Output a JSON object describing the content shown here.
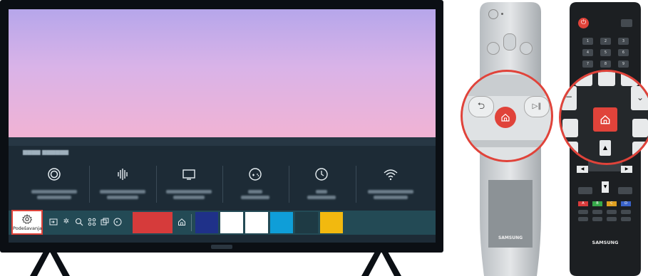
{
  "tv": {
    "settings_label": "Podešavanja",
    "bar_icons": [
      "input-source-icon",
      "ambient-icon",
      "search-icon",
      "apps-icon",
      "multi-view-icon",
      "gaming-hub-icon"
    ],
    "quick_settings_icons": [
      "picture-mode-icon",
      "sound-output-icon",
      "display-icon",
      "game-mode-icon",
      "sleep-timer-icon",
      "network-icon"
    ],
    "app_tiles": [
      {
        "name": "red",
        "color": "#d63b3b"
      },
      {
        "name": "navy",
        "color": "#1f3189"
      },
      {
        "name": "white1",
        "color": "#ffffff"
      },
      {
        "name": "white2",
        "color": "#ffffff"
      },
      {
        "name": "blue",
        "color": "#0f9ed8"
      },
      {
        "name": "dark",
        "color": "#1e3a44"
      },
      {
        "name": "yellow",
        "color": "#f2b90f"
      }
    ]
  },
  "remote1": {
    "brand": "SAMSUNG"
  },
  "remote2": {
    "brand": "SAMSUNG",
    "numbers": [
      "1",
      "2",
      "3",
      "4",
      "5",
      "6",
      "7",
      "8",
      "9"
    ],
    "color_keys": [
      {
        "label": "A",
        "color": "#d93b3b"
      },
      {
        "label": "B",
        "color": "#37a84a"
      },
      {
        "label": "C",
        "color": "#e0a020"
      },
      {
        "label": "D",
        "color": "#3a63c9"
      }
    ]
  },
  "colors": {
    "highlight": "#e0433a",
    "bar": "#234a55",
    "screen_panel": "#1d2b36"
  }
}
